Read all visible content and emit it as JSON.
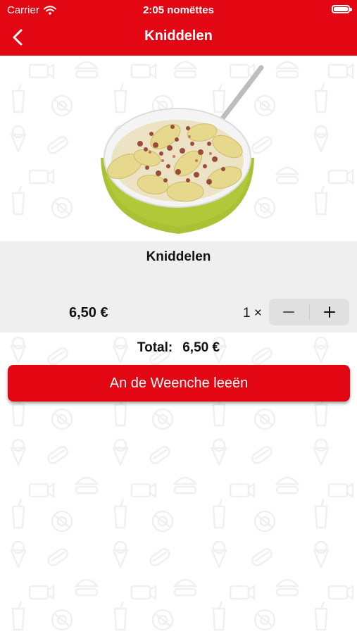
{
  "status_bar": {
    "carrier": "Carrier",
    "time": "2:05 nomëttes"
  },
  "nav": {
    "title": "Kniddelen"
  },
  "product": {
    "name": "Kniddelen",
    "price": "6,50 €"
  },
  "quantity": {
    "label": "1 ×",
    "value": 1
  },
  "total": {
    "label": "Total:",
    "value": "6,50 €"
  },
  "cta": {
    "label": "An de Weenche leeën"
  },
  "colors": {
    "brand_red": "#e30613",
    "panel_gray": "#efefef",
    "stepper_gray": "#e0e0e0"
  },
  "icons": [
    "wifi-icon",
    "battery-icon",
    "back-chevron-icon",
    "minus-icon",
    "plus-icon"
  ]
}
